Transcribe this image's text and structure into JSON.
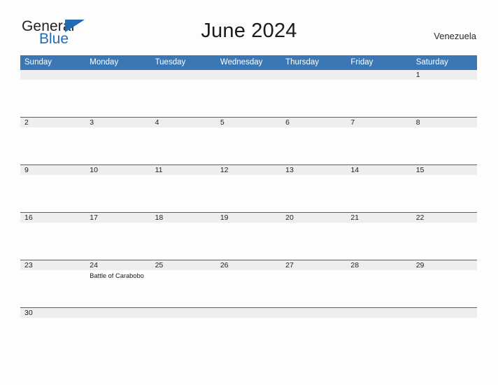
{
  "brand": {
    "word_one": "General",
    "word_two": "Blue",
    "triangle_icon": "triangle-icon",
    "color_blue": "#1f6cb5",
    "color_dark": "#231f20"
  },
  "header": {
    "title": "June 2024",
    "region": "Venezuela"
  },
  "calendar": {
    "header_bg": "#3c77b5",
    "daynum_bg": "#eeeeee",
    "rule_color": "#2f6ca8",
    "weekdays": [
      "Sunday",
      "Monday",
      "Tuesday",
      "Wednesday",
      "Thursday",
      "Friday",
      "Saturday"
    ],
    "weeks": [
      {
        "days": [
          {
            "num": "",
            "events": []
          },
          {
            "num": "",
            "events": []
          },
          {
            "num": "",
            "events": []
          },
          {
            "num": "",
            "events": []
          },
          {
            "num": "",
            "events": []
          },
          {
            "num": "",
            "events": []
          },
          {
            "num": "1",
            "events": []
          }
        ]
      },
      {
        "days": [
          {
            "num": "2",
            "events": []
          },
          {
            "num": "3",
            "events": []
          },
          {
            "num": "4",
            "events": []
          },
          {
            "num": "5",
            "events": []
          },
          {
            "num": "6",
            "events": []
          },
          {
            "num": "7",
            "events": []
          },
          {
            "num": "8",
            "events": []
          }
        ]
      },
      {
        "days": [
          {
            "num": "9",
            "events": []
          },
          {
            "num": "10",
            "events": []
          },
          {
            "num": "11",
            "events": []
          },
          {
            "num": "12",
            "events": []
          },
          {
            "num": "13",
            "events": []
          },
          {
            "num": "14",
            "events": []
          },
          {
            "num": "15",
            "events": []
          }
        ]
      },
      {
        "days": [
          {
            "num": "16",
            "events": []
          },
          {
            "num": "17",
            "events": []
          },
          {
            "num": "18",
            "events": []
          },
          {
            "num": "19",
            "events": []
          },
          {
            "num": "20",
            "events": []
          },
          {
            "num": "21",
            "events": []
          },
          {
            "num": "22",
            "events": []
          }
        ]
      },
      {
        "days": [
          {
            "num": "23",
            "events": []
          },
          {
            "num": "24",
            "events": [
              "Battle of Carabobo"
            ]
          },
          {
            "num": "25",
            "events": []
          },
          {
            "num": "26",
            "events": []
          },
          {
            "num": "27",
            "events": []
          },
          {
            "num": "28",
            "events": []
          },
          {
            "num": "29",
            "events": []
          }
        ]
      },
      {
        "short": true,
        "days": [
          {
            "num": "30",
            "events": []
          },
          {
            "num": "",
            "events": []
          },
          {
            "num": "",
            "events": []
          },
          {
            "num": "",
            "events": []
          },
          {
            "num": "",
            "events": []
          },
          {
            "num": "",
            "events": []
          },
          {
            "num": "",
            "events": []
          }
        ]
      }
    ]
  }
}
